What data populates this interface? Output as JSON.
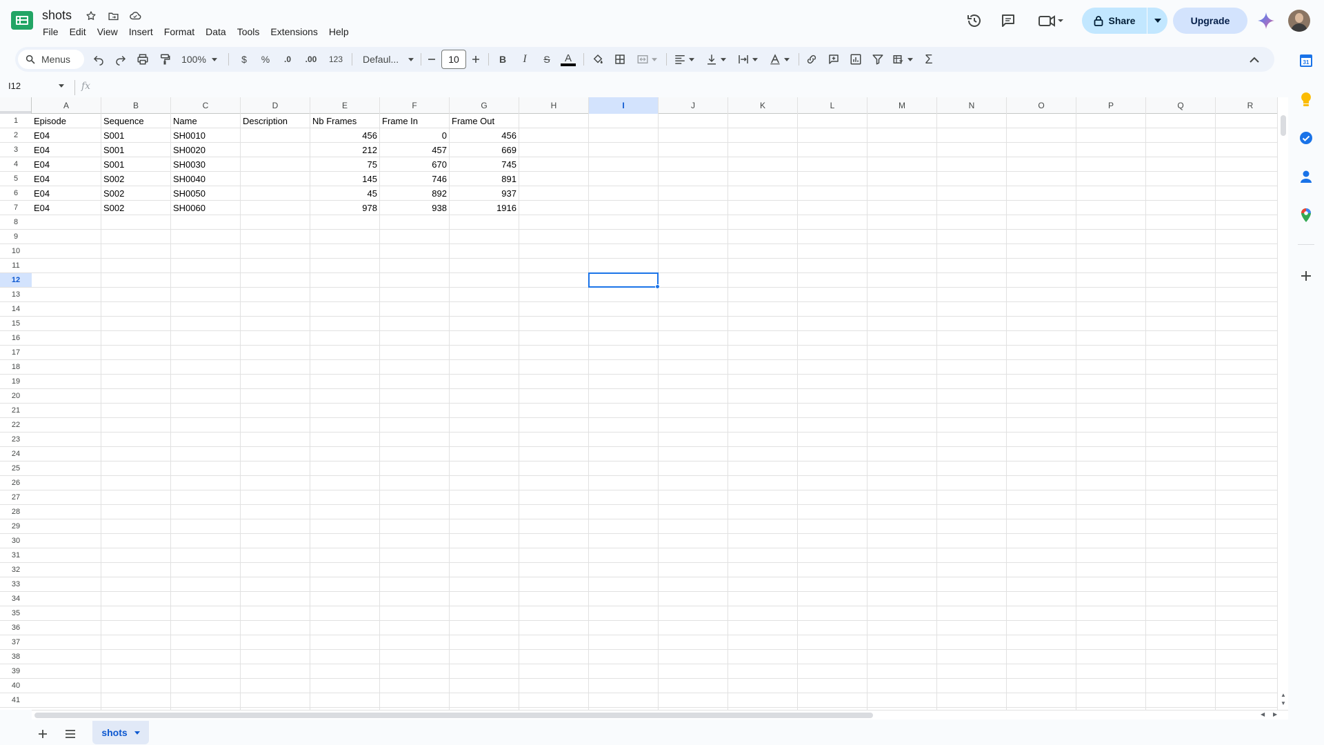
{
  "app": {
    "title": "shots",
    "menu": [
      "File",
      "Edit",
      "View",
      "Insert",
      "Format",
      "Data",
      "Tools",
      "Extensions",
      "Help"
    ],
    "share_label": "Share",
    "upgrade_label": "Upgrade",
    "accent_color": "#0b57d0"
  },
  "toolbar": {
    "search_label": "Menus",
    "zoom": "100%",
    "currency": "$",
    "percent": "%",
    "dec_decrease": ".0",
    "dec_increase": ".00",
    "number_format": "123",
    "font": "Defaul...",
    "font_size": "10",
    "bold": "B",
    "italic": "I",
    "strike": "S",
    "text_color_label": "A",
    "text_color": "#000000",
    "sum": "Σ"
  },
  "formula_bar": {
    "name_box": "I12",
    "fx": "fx",
    "formula": ""
  },
  "grid": {
    "columns": [
      "A",
      "B",
      "C",
      "D",
      "E",
      "F",
      "G",
      "H",
      "I",
      "J",
      "K",
      "L",
      "M",
      "N",
      "O",
      "P",
      "Q",
      "R"
    ],
    "selected_column": "I",
    "selected_row": "12",
    "row_count": 41,
    "header_row": [
      "Episode",
      "Sequence",
      "Name",
      "Description",
      "Nb Frames",
      "Frame In",
      "Frame Out"
    ],
    "rows": [
      [
        "E04",
        "S001",
        "SH0010",
        "",
        "456",
        "0",
        "456"
      ],
      [
        "E04",
        "S001",
        "SH0020",
        "",
        "212",
        "457",
        "669"
      ],
      [
        "E04",
        "S001",
        "SH0030",
        "",
        "75",
        "670",
        "745"
      ],
      [
        "E04",
        "S002",
        "SH0040",
        "",
        "145",
        "746",
        "891"
      ],
      [
        "E04",
        "S002",
        "SH0050",
        "",
        "45",
        "892",
        "937"
      ],
      [
        "E04",
        "S002",
        "SH0060",
        "",
        "978",
        "938",
        "1916"
      ]
    ]
  },
  "sheets": {
    "tabs": [
      "shots"
    ],
    "active": "shots"
  },
  "side_panel": {
    "calendar_label": "31"
  }
}
